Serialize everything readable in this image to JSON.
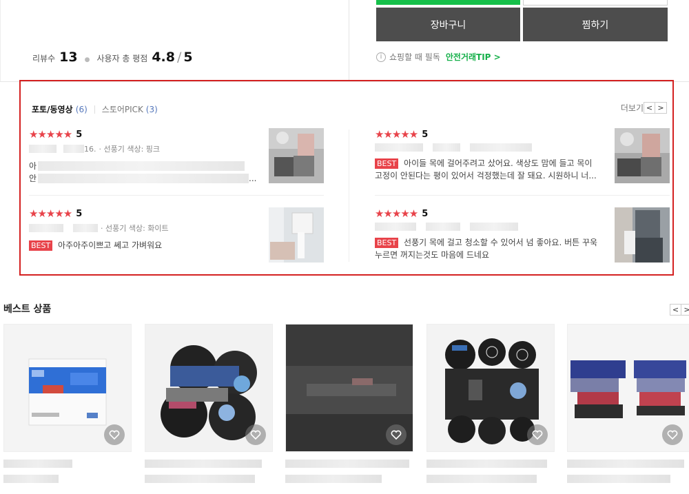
{
  "top": {
    "review_label": "리뷰수",
    "review_count": "13",
    "rating_label": "사용자 총 평점",
    "rating_value": "4.8",
    "rating_max": "5",
    "cart_button": "장바구니",
    "wish_button": "찜하기",
    "tip_text": "쇼핑할 때 필독",
    "tip_link": "안전거래TIP >"
  },
  "reviews_section": {
    "tab_photo_label": "포토/동영상",
    "tab_photo_count": "(6)",
    "tab_pick_label": "스토어PICK",
    "tab_pick_count": "(3)",
    "more_label": "더보기",
    "prev": "<",
    "next": ">",
    "reviews": [
      {
        "stars": "★★★★★",
        "score": "5",
        "date_suffix": "16.",
        "option": "· 선풍기 색상: 핑크",
        "best_badge": "",
        "text_line1": "아",
        "text_line2": "안",
        "ellipsis": "..."
      },
      {
        "stars": "★★★★★",
        "score": "5",
        "date_suffix": "",
        "option": "",
        "best_badge": "BEST",
        "text_line1": "아이들 목에 걸어주려고 샀어요. 색상도 맘에 들고 목이",
        "text_line2": "고정이 안된다는 평이 있어서 걱정했는데 잘 돼요. 시원하니 너...",
        "ellipsis": ""
      },
      {
        "stars": "★★★★★",
        "score": "5",
        "date_suffix": "",
        "option": "· 선풍기 색상: 화이트",
        "best_badge": "BEST",
        "text_line1": "아주아주이쁘고 쎄고 가벼워요",
        "text_line2": "",
        "ellipsis": ""
      },
      {
        "stars": "★★★★★",
        "score": "5",
        "date_suffix": "",
        "option": "",
        "best_badge": "BEST",
        "text_line1": "선풍기 목에 걸고 청소할 수 있어서 넘 좋아요. 버튼 꾸욱",
        "text_line2": "누르면 꺼지는것도 마음에 드네요",
        "ellipsis": ""
      }
    ]
  },
  "best_products": {
    "title": "베스트 상품",
    "prev": "<",
    "next": ">"
  },
  "colors": {
    "accent_green": "#16c04a",
    "highlight_red": "#d42020",
    "star_red": "#e8434a",
    "dark_button": "#4d4d4d"
  }
}
